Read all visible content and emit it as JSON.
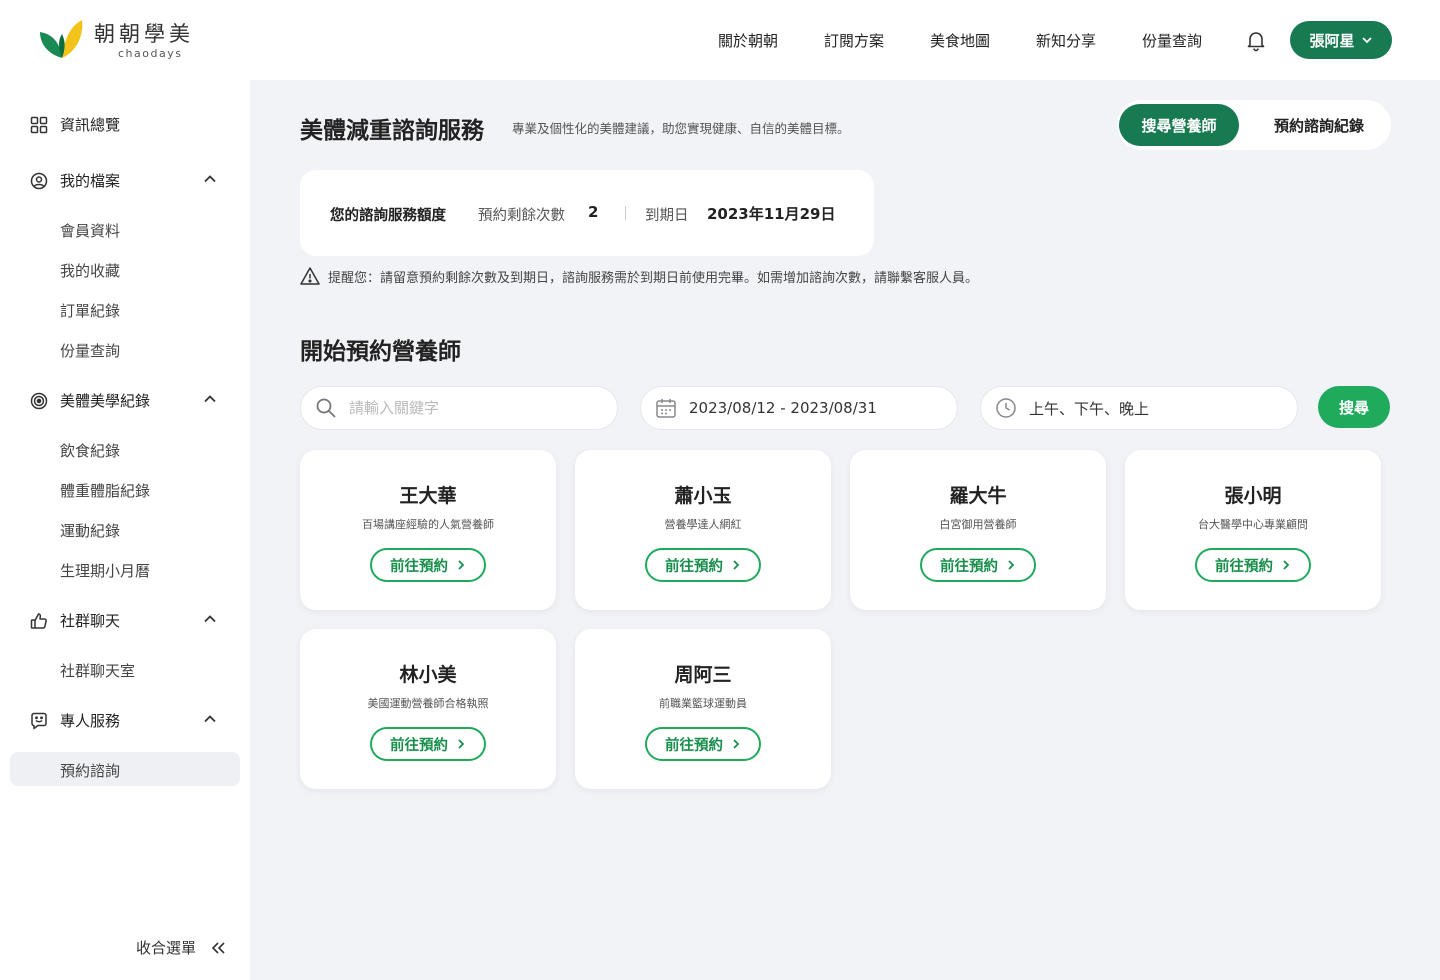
{
  "brand": {
    "name_cn": "朝朝學美",
    "name_en": "chaodays"
  },
  "nav": {
    "items": [
      "關於朝朝",
      "訂閱方案",
      "美食地圖",
      "新知分享",
      "份量查詢"
    ],
    "user_label": "張阿星"
  },
  "sidebar": {
    "overview": "資訊總覽",
    "profile": {
      "label": "我的檔案",
      "items": [
        "會員資料",
        "我的收藏",
        "訂單紀錄",
        "份量查詢"
      ]
    },
    "records": {
      "label": "美體美學紀錄",
      "items": [
        "飲食紀錄",
        "體重體脂紀錄",
        "運動紀錄",
        "生理期小月曆"
      ]
    },
    "community": {
      "label": "社群聊天",
      "items": [
        "社群聊天室"
      ]
    },
    "service": {
      "label": "專人服務",
      "items": [
        "預約諮詢"
      ]
    },
    "collapse_label": "收合選單"
  },
  "header": {
    "title": "美體減重諮詢服務",
    "subtitle": "專業及個性化的美體建議，助您實現健康、自信的美體目標。",
    "tab_search": "搜尋營養師",
    "tab_records": "預約諮詢紀錄"
  },
  "quota": {
    "label": "您的諮詢服務額度",
    "remaining_label": "預約剩餘次數",
    "remaining": "2",
    "expiry_label": "到期日",
    "expiry": "2023年11月29日"
  },
  "notice": "提醒您：請留意預約剩餘次數及到期日，諮詢服務需於到期日前使用完畢。如需增加諮詢次數，請聯繫客服人員。",
  "booking": {
    "title": "開始預約營養師",
    "search_placeholder": "請輸入關鍵字",
    "date_range": "2023/08/12 - 2023/08/31",
    "time_slots": "上午、下午、晚上",
    "search_button": "搜尋"
  },
  "book_label": "前往預約",
  "nutritionists": [
    {
      "name": "王大華",
      "desc": "百場講座經驗的人氣營養師"
    },
    {
      "name": "蕭小玉",
      "desc": "營養學達人網紅"
    },
    {
      "name": "羅大牛",
      "desc": "白宮御用營養師"
    },
    {
      "name": "張小明",
      "desc": "台大醫學中心專業顧問"
    },
    {
      "name": "林小美",
      "desc": "美國運動營養師合格執照"
    },
    {
      "name": "周阿三",
      "desc": "前職業籃球運動員"
    }
  ],
  "colors": {
    "brand_green": "#177a50",
    "action_green": "#1faa5c",
    "bg": "#f2f3f7"
  }
}
